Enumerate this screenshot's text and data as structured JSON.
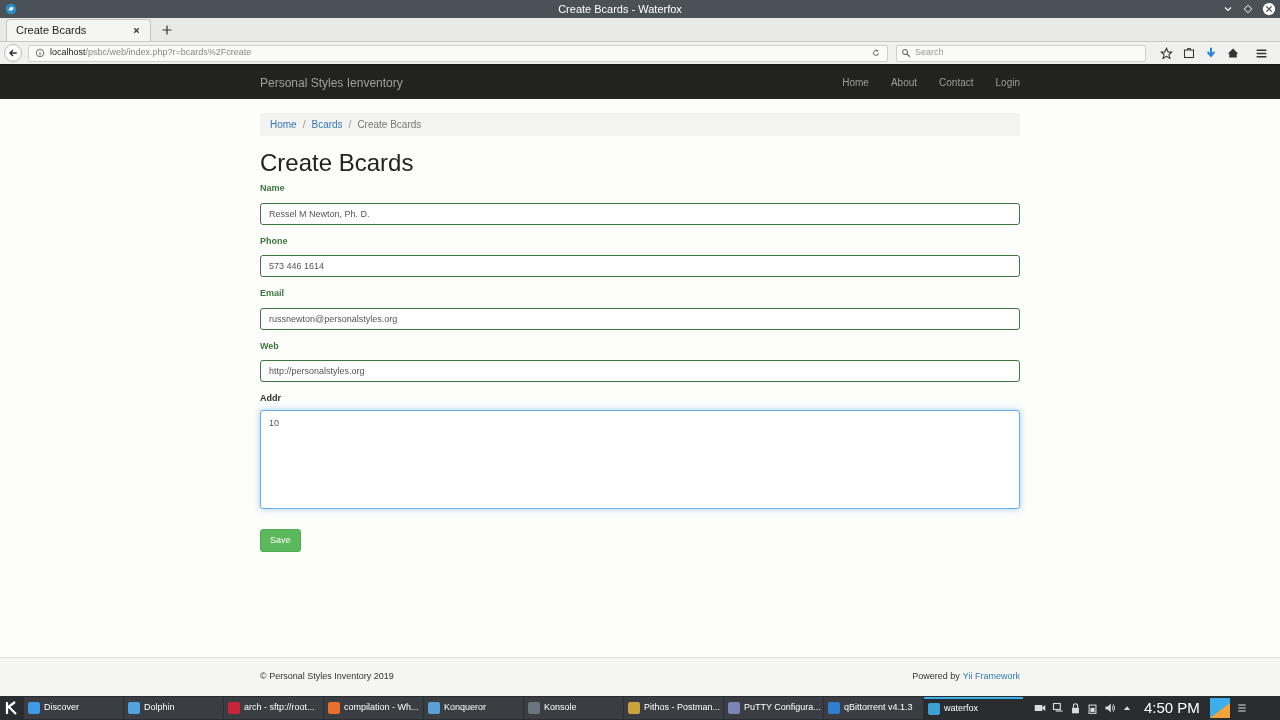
{
  "window": {
    "title": "Create Bcards - Waterfox"
  },
  "tabs": [
    {
      "label": "Create Bcards",
      "selected": true
    }
  ],
  "address_bar": {
    "host": "localhost",
    "path": "/psbc/web/index.php?r=bcards%2Fcreate"
  },
  "search": {
    "placeholder": "Search"
  },
  "navbar": {
    "brand": "Personal Styles Ienventory",
    "links": [
      "Home",
      "About",
      "Contact",
      "Login"
    ]
  },
  "breadcrumb_separator": "/",
  "breadcrumb": [
    {
      "label": "Home",
      "link": true
    },
    {
      "label": "Bcards",
      "link": true
    },
    {
      "label": "Create Bcards",
      "link": false
    }
  ],
  "heading": "Create Bcards",
  "fields": [
    {
      "label": "Name",
      "value": "Ressel M Newton, Ph. D.",
      "kind": "input",
      "valid": true,
      "focused": false
    },
    {
      "label": "Phone",
      "value": "573 446 1614",
      "kind": "input",
      "valid": true,
      "focused": false
    },
    {
      "label": "Email",
      "value": "russnewton@personalstyles.org",
      "kind": "input",
      "valid": true,
      "focused": false
    },
    {
      "label": "Web",
      "value": "http://personalstyles.org",
      "kind": "input",
      "valid": true,
      "focused": false
    },
    {
      "label": "Addr",
      "value": "10",
      "kind": "textarea",
      "valid": false,
      "focused": true
    }
  ],
  "save_button": "Save",
  "footer": {
    "copyright": "© Personal Styles Inventory 2019",
    "powered_by": "Powered by",
    "framework_link": "Yii Framework"
  },
  "taskbar": {
    "items": [
      {
        "label": "Discover",
        "selected": false,
        "color": "#3d9ae8"
      },
      {
        "label": "Dolphin",
        "selected": false,
        "color": "#4fa3e0"
      },
      {
        "label": "arch - sftp://root...",
        "selected": false,
        "color": "#c8253a"
      },
      {
        "label": "compilation - Wh...",
        "selected": false,
        "color": "#e8702a"
      },
      {
        "label": "Konqueror",
        "selected": false,
        "color": "#5aa0d8"
      },
      {
        "label": "Konsole",
        "selected": false,
        "color": "#6b7480"
      },
      {
        "label": "Pithos - Postman...",
        "selected": false,
        "color": "#c9a43a"
      },
      {
        "label": "PuTTY Configura...",
        "selected": false,
        "color": "#7a86b8"
      },
      {
        "label": "qBittorrent v4.1.3",
        "selected": false,
        "color": "#2f7fd1"
      },
      {
        "label": "waterfox",
        "selected": true,
        "color": "#3aa0d6"
      }
    ],
    "clock": "4:50 PM"
  }
}
